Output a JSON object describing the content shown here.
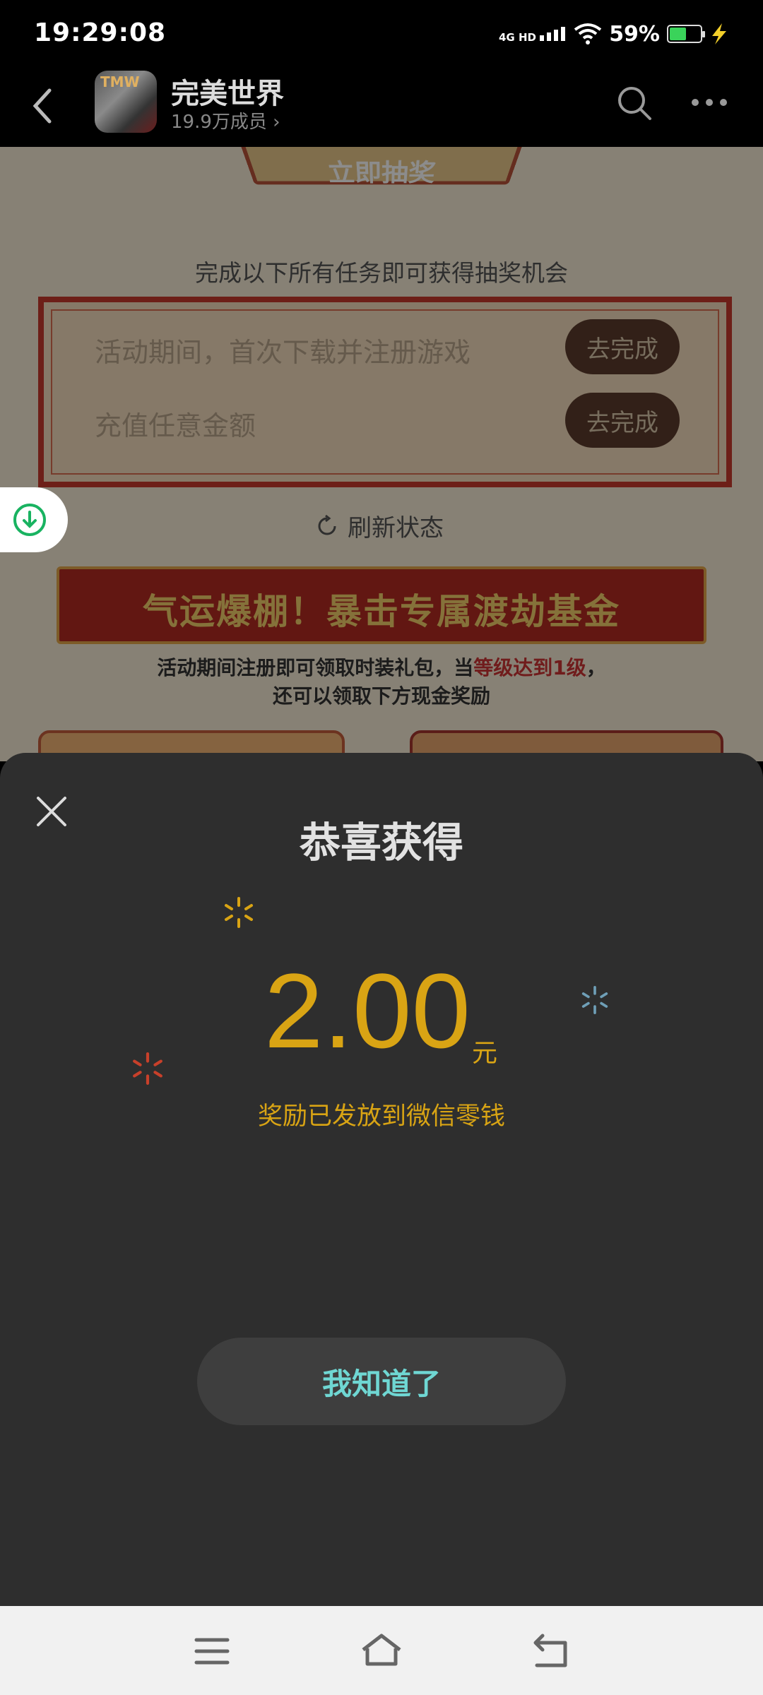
{
  "status_bar": {
    "time": "19:29:08",
    "network": "4G HD",
    "battery_percent": "59%",
    "battery_level": 0.59,
    "icons": [
      "signal-icon",
      "wifi-icon",
      "battery-icon",
      "charging-icon"
    ]
  },
  "header": {
    "group_name": "完美世界",
    "members": "19.9万成员",
    "avatar_text": "TMW",
    "icons": [
      "back-icon",
      "search-icon",
      "more-icon"
    ]
  },
  "page": {
    "draw_button": "立即抽奖",
    "task_hint": "完成以下所有任务即可获得抽奖机会",
    "tasks": [
      {
        "label": "活动期间，首次下载并注册游戏",
        "button": "去完成"
      },
      {
        "label": "充值任意金额",
        "button": "去完成"
      }
    ],
    "refresh": "刷新状态",
    "banner": "气运爆棚！暴击专属渡劫基金",
    "desc_part1": "活动期间注册即可领取时装礼包，当",
    "desc_highlight": "等级达到1级",
    "desc_part2": "，",
    "desc_line2": "还可以领取下方现金奖励"
  },
  "sheet": {
    "title": "恭喜获得",
    "amount": "2.00",
    "unit": "元",
    "note": "奖励已发放到微信零钱",
    "confirm": "我知道了"
  },
  "colors": {
    "accent_gold": "#d9a414",
    "confirm_text": "#6fd7d3",
    "sheet_bg": "#2e2e2e",
    "download_green": "#19b361"
  }
}
